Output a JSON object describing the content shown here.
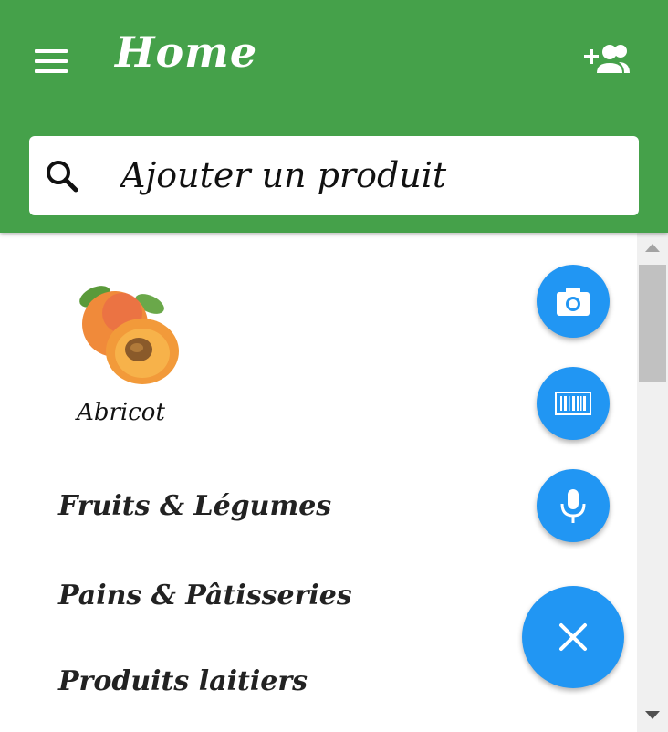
{
  "header": {
    "title": "Home",
    "menu_icon": "menu-icon",
    "add_user_icon": "person-add-icon"
  },
  "search": {
    "placeholder": "Ajouter un produit",
    "icon": "search-icon"
  },
  "product": {
    "label": "Abricot"
  },
  "categories": [
    {
      "label": "Fruits & Légumes"
    },
    {
      "label": "Pains & Pâtisseries"
    },
    {
      "label": "Produits laitiers"
    }
  ],
  "fabs": [
    {
      "icon": "camera-icon"
    },
    {
      "icon": "barcode-icon"
    },
    {
      "icon": "microphone-icon"
    },
    {
      "icon": "close-icon"
    }
  ],
  "colors": {
    "appbar": "#45a14a",
    "fab": "#2196f3"
  }
}
